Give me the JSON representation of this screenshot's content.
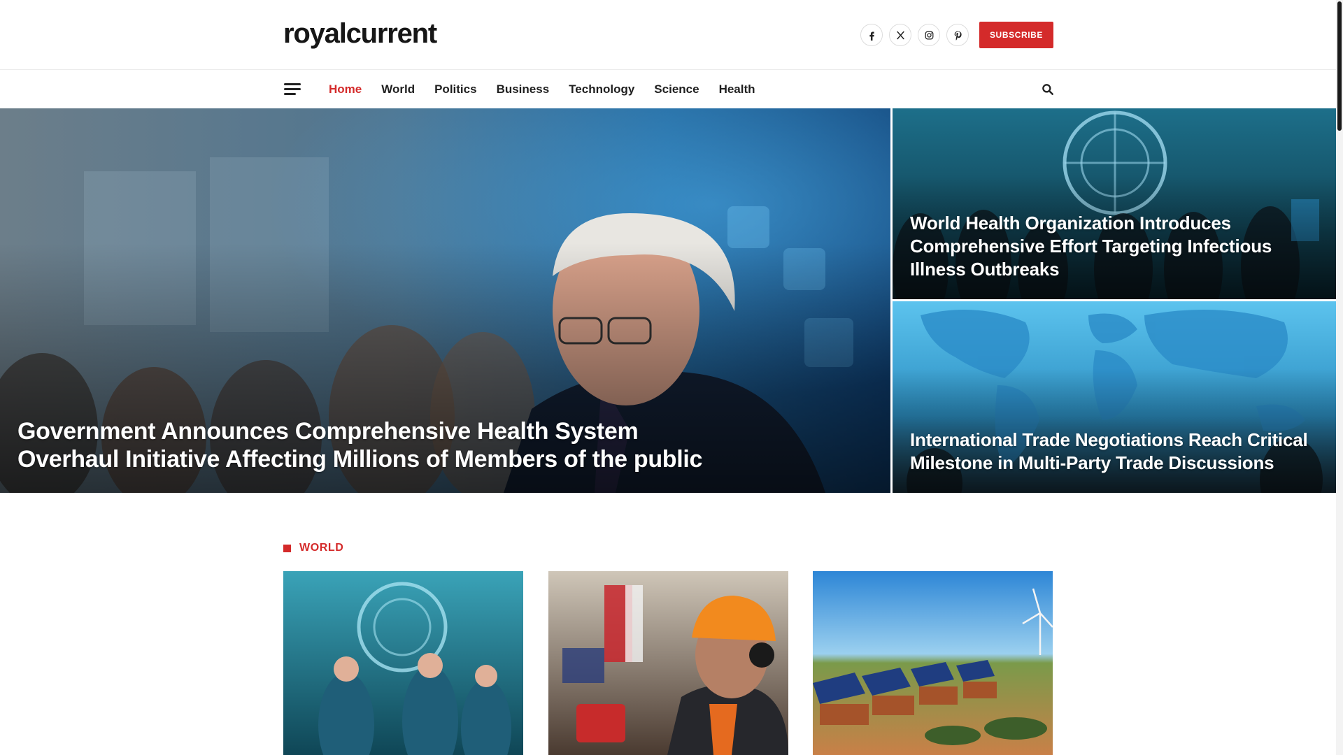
{
  "header": {
    "logo": "royalcurrent",
    "socials": [
      {
        "icon": "facebook-icon"
      },
      {
        "icon": "x-icon"
      },
      {
        "icon": "instagram-icon"
      },
      {
        "icon": "pinterest-icon"
      }
    ],
    "subscribe_label": "SUBSCRIBE"
  },
  "nav": {
    "items": [
      {
        "label": "Home",
        "active": true
      },
      {
        "label": "World",
        "active": false
      },
      {
        "label": "Politics",
        "active": false
      },
      {
        "label": "Business",
        "active": false
      },
      {
        "label": "Technology",
        "active": false
      },
      {
        "label": "Science",
        "active": false
      },
      {
        "label": "Health",
        "active": false
      }
    ],
    "menu_icon": "hamburger-menu-icon",
    "search_icon": "search-icon"
  },
  "hero": {
    "main": {
      "title": "Government Announces Comprehensive Health System Overhaul Initiative Affecting Millions of Members of the public",
      "image": "official-at-briefing-photo"
    },
    "side": [
      {
        "title": "World Health Organization Introduces Comprehensive Effort Targeting Infectious Illness Outbreaks",
        "image": "un-health-meeting-photo"
      },
      {
        "title": "International Trade Negotiations Reach Critical Milestone in Multi-Party Trade Discussions",
        "image": "world-map-conference-photo"
      }
    ]
  },
  "section": {
    "label": "WORLD",
    "cards": [
      {
        "image": "un-delegates-masks-photo"
      },
      {
        "image": "factory-worker-hardhat-photo"
      },
      {
        "image": "solar-village-wind-turbines-photo"
      }
    ]
  },
  "colors": {
    "accent": "#d42a2a",
    "text": "#1f1f1f"
  }
}
